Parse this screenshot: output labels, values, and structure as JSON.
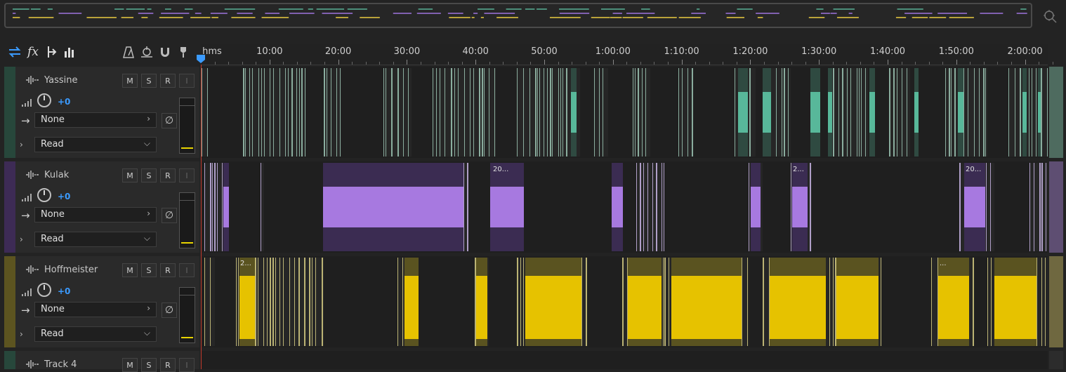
{
  "toolbar": {
    "icons": [
      "switch-view-icon",
      "fx-icon",
      "multitrack-send-icon",
      "meter-icon",
      "metronome-icon",
      "automation-icon",
      "snap-icon",
      "marker-icon"
    ]
  },
  "ruler": {
    "labels": [
      "hms",
      "10:00",
      "20:00",
      "30:00",
      "40:00",
      "50:00",
      "1:00:00",
      "1:10:00",
      "1:20:00",
      "1:30:00",
      "1:40:00",
      "1:50:00",
      "2:00:00"
    ]
  },
  "tracks": [
    {
      "name": "Yassine",
      "color": "#27473b",
      "clip_color": "#58b89a",
      "mute": "M",
      "solo": "S",
      "record": "R",
      "input": "I",
      "volume": "+0",
      "output": "None",
      "automation": "Read"
    },
    {
      "name": "Kulak",
      "color": "#3d2b55",
      "clip_color": "#a779e0",
      "mute": "M",
      "solo": "S",
      "record": "R",
      "input": "I",
      "volume": "+0",
      "output": "None",
      "automation": "Read"
    },
    {
      "name": "Hoffmeister",
      "color": "#5c5420",
      "clip_color": "#e6c200",
      "mute": "M",
      "solo": "S",
      "record": "R",
      "input": "I",
      "volume": "+0",
      "output": "None",
      "automation": "Read"
    },
    {
      "name": "Track 4",
      "color": "#27473b",
      "mute": "M",
      "solo": "S",
      "record": "R",
      "input": "I"
    }
  ],
  "clip_labels": {
    "kulak": [
      "20...",
      "2...",
      "20..."
    ],
    "hoffmeister": [
      "2...",
      "..."
    ]
  }
}
